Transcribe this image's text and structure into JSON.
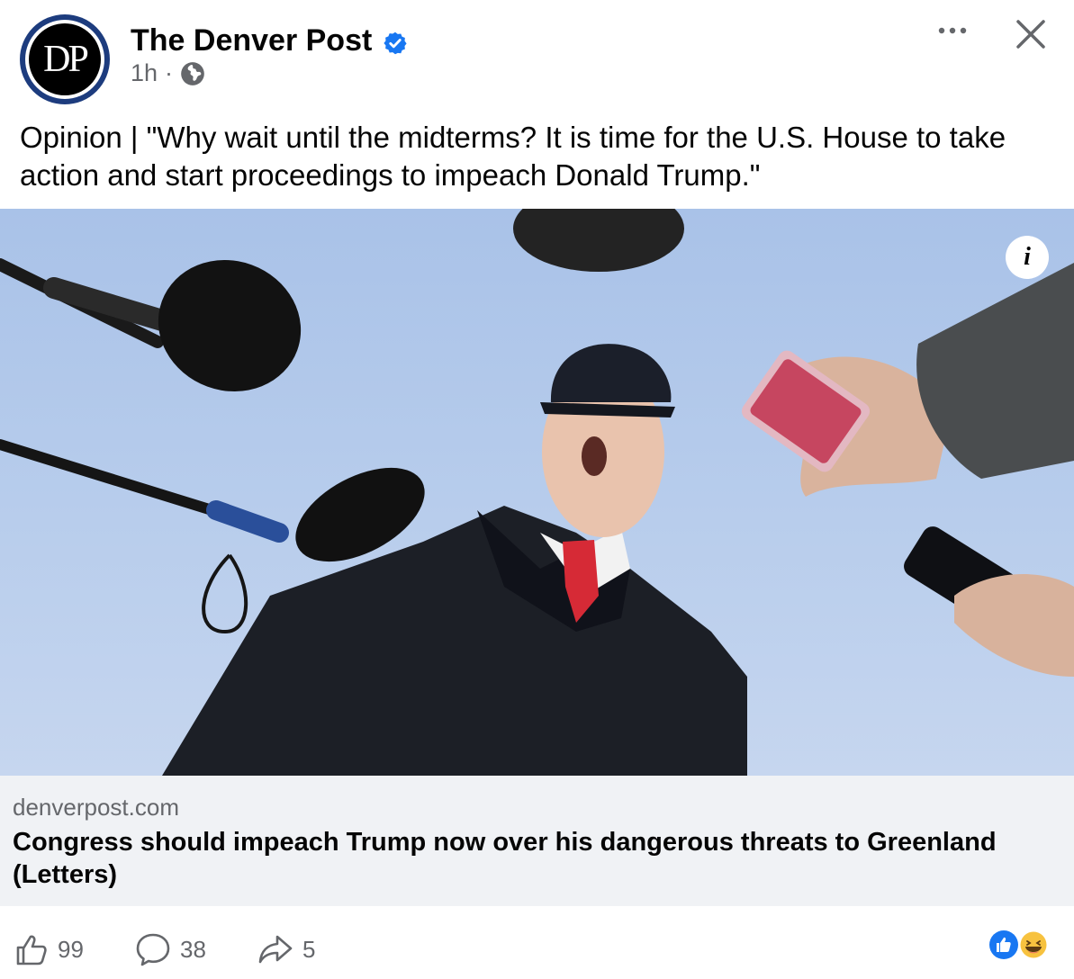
{
  "post": {
    "page_name": "The Denver Post",
    "avatar_text": "DP",
    "time": "1h",
    "separator": "·",
    "text": "Opinion | \"Why wait until the midterms? It is time for the U.S. House to take action and start proceedings to impeach Donald Trump.\"",
    "info_label": "i"
  },
  "link": {
    "domain": "denverpost.com",
    "title": "Congress should impeach Trump now over his dangerous threats to Greenland (Letters)"
  },
  "actions": {
    "likes": "99",
    "comments": "38",
    "shares": "5"
  },
  "icons": {
    "verified": "verified-badge-icon",
    "audience": "globe-icon",
    "more": "more-dots-icon",
    "close": "close-icon",
    "like": "thumbs-up-icon",
    "comment": "comment-bubble-icon",
    "share": "share-arrow-icon",
    "reactions": [
      "like-reaction-icon",
      "haha-reaction-icon"
    ]
  },
  "colors": {
    "verified_blue": "#1877f2",
    "secondary_text": "#65676b",
    "link_bg": "#f0f2f5",
    "avatar_ring": "#1d3c7e"
  }
}
